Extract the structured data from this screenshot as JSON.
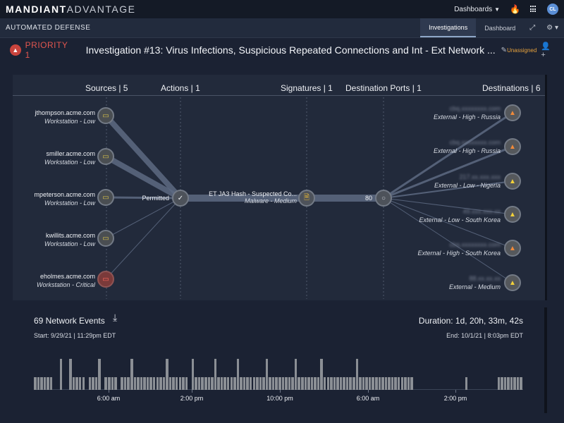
{
  "app": {
    "brand_bold": "MANDIANT",
    "brand_light": "ADVANTAGE"
  },
  "topbar": {
    "dashboards_label": "Dashboards",
    "user_initials": "CL"
  },
  "section": {
    "title": "AUTOMATED DEFENSE",
    "tabs": [
      {
        "label": "Investigations",
        "active": true
      },
      {
        "label": "Dashboard",
        "active": false
      }
    ]
  },
  "investigation": {
    "priority_label": "PRIORITY 1",
    "title": "Investigation #13: Virus Infections, Suspicious Repeated Connections and Int - Ext Network ...",
    "assignee": "Unassigned"
  },
  "graph": {
    "headers": {
      "sources": "Sources | 5",
      "actions": "Actions | 1",
      "signatures": "Signatures | 1",
      "ports": "Destination Ports | 1",
      "destinations": "Destinations | 6"
    },
    "sources": [
      {
        "host": "jthompson.acme.com",
        "detail": "Workstation - Low",
        "icon": "monitor-icon"
      },
      {
        "host": "smiller.acme.com",
        "detail": "Workstation - Low",
        "icon": "monitor-icon"
      },
      {
        "host": "mpeterson.acme.com",
        "detail": "Workstation - Low",
        "icon": "monitor-icon"
      },
      {
        "host": "kwillits.acme.com",
        "detail": "Workstation - Low",
        "icon": "monitor-icon"
      },
      {
        "host": "eholmes.acme.com",
        "detail": "Workstation - Critical",
        "icon": "monitor-icon"
      }
    ],
    "action": {
      "label": "Permitted",
      "icon": "check-icon"
    },
    "signature": {
      "name": "ET JA3 Hash - Suspected Co...",
      "detail": "Malware - Medium",
      "icon": "document-icon"
    },
    "port": {
      "label": "80",
      "icon": "circle-icon"
    },
    "destinations": [
      {
        "host": "cbq.xxxxxxxx.com",
        "detail": "External - High - Russia",
        "level": "high"
      },
      {
        "host": "cbq.xxxxxxxx.com",
        "detail": "External - High - Russia",
        "level": "high"
      },
      {
        "host": "217.xx.xxx.xxx",
        "detail": "External - Low - Nigeria",
        "level": "low"
      },
      {
        "host": "49.xxx.xxx.xx",
        "detail": "External - Low - South Korea",
        "level": "low"
      },
      {
        "host": "cbq.xxxxxxxx.com",
        "detail": "External - High - South Korea",
        "level": "high"
      },
      {
        "host": "88.xx.xx.xx",
        "detail": "External - Medium",
        "level": "low"
      }
    ]
  },
  "events": {
    "count_label": "69 Network Events",
    "start": "Start: 9/29/21 | 11:29pm EDT",
    "duration": "Duration: 1d, 20h, 33m, 42s",
    "end": "End: 10/1/21 | 8:03pm EDT",
    "axis_ticks": [
      "6:00 am",
      "2:00 pm",
      "10:00 pm",
      "6:00 am",
      "2:00 pm"
    ],
    "histogram_levels": [
      0.4,
      0.4,
      0.4,
      0.4,
      0.4,
      0.4,
      0,
      0,
      1,
      0,
      0,
      1,
      0.4,
      0.4,
      0.4,
      0.4,
      0,
      0.4,
      0.4,
      0.4,
      1,
      0,
      0.4,
      0.4,
      0.4,
      0.4,
      0,
      0.4,
      0.4,
      0.4,
      1,
      0.4,
      0.4,
      0.4,
      0.4,
      0.4,
      0.4,
      0.4,
      0.4,
      0.4,
      0.4,
      1,
      0.4,
      0.4,
      0.4,
      0.4,
      0.4,
      0.4,
      0,
      1,
      0.4,
      0.4,
      0.4,
      0.4,
      0.4,
      0.4,
      1,
      0.4,
      0.4,
      0.4,
      0.4,
      0.4,
      0.4,
      1,
      0.4,
      0.4,
      0.4,
      0.4,
      0.4,
      0.4,
      0.4,
      0.4,
      1,
      0.4,
      0.4,
      0.4,
      0.4,
      0.4,
      0.4,
      0.4,
      0.4,
      1,
      0.4,
      0.4,
      0.4,
      0.4,
      0.4,
      0.4,
      0.4,
      1,
      0.4,
      0.4,
      0.4,
      0.4,
      0.4,
      0.4,
      0.4,
      0.4,
      0.4,
      0.4,
      1,
      0.4,
      0.4,
      0.4,
      0.4,
      0.4,
      0.4,
      0.4,
      0.4,
      0.4,
      0.4,
      0.4,
      0.4,
      0.4,
      0.4,
      0.4,
      0.4,
      0.4,
      0,
      0,
      0,
      0,
      0,
      0,
      0,
      0,
      0,
      0,
      0,
      0,
      0,
      0,
      0,
      0,
      0.4,
      0,
      0,
      0,
      0,
      0,
      0,
      0,
      0,
      0,
      0.4,
      0.4,
      0.4,
      0.4,
      0.4,
      0.4,
      0.4,
      0.4
    ]
  },
  "colors": {
    "priority": "#e0564f",
    "assignee": "#e8a33d",
    "accent_tab": "#2f3a50"
  }
}
